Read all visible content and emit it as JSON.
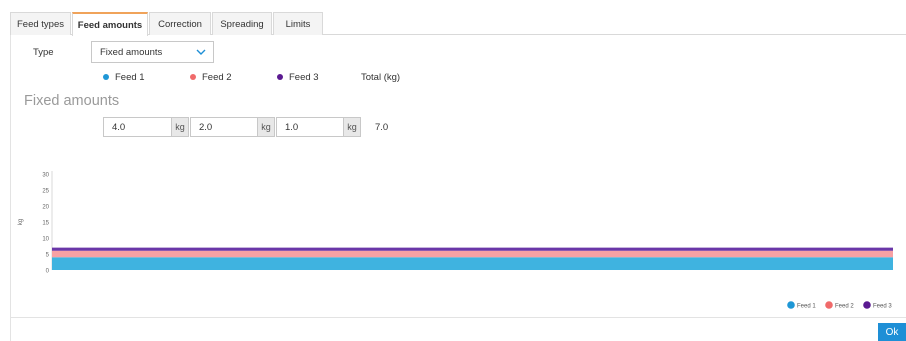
{
  "tabs": [
    {
      "label": "Feed types"
    },
    {
      "label": "Feed amounts"
    },
    {
      "label": "Correction"
    },
    {
      "label": "Spreading"
    },
    {
      "label": "Limits"
    }
  ],
  "type_row": {
    "label": "Type",
    "selected": "Fixed amounts"
  },
  "legend": [
    {
      "label": "Feed 1",
      "color": "#1f97d6"
    },
    {
      "label": "Feed 2",
      "color": "#f06a6a"
    },
    {
      "label": "Feed 3",
      "color": "#5b1a91"
    }
  ],
  "total_label": "Total (kg)",
  "section_title": "Fixed amounts",
  "amounts": [
    {
      "value": "4.0",
      "unit": "kg"
    },
    {
      "value": "2.0",
      "unit": "kg"
    },
    {
      "value": "1.0",
      "unit": "kg"
    }
  ],
  "total_value": "7.0",
  "ok_label": "Ok",
  "chart_data": {
    "type": "area",
    "stacked": true,
    "ylabel": "kg",
    "ylim": [
      0,
      30
    ],
    "yticks": [
      "30",
      "25",
      "20",
      "15",
      "10",
      "5",
      "0"
    ],
    "series": [
      {
        "name": "Feed 1",
        "values": [
          4.0,
          4.0
        ],
        "color": "#3fb3e0"
      },
      {
        "name": "Feed 2",
        "values": [
          2.0,
          2.0
        ],
        "color": "#f7a1a4"
      },
      {
        "name": "Feed 3",
        "values": [
          1.0,
          1.0
        ],
        "color": "#6a36a8"
      }
    ],
    "legend_position": "bottom-right",
    "legend": [
      {
        "label": "Feed 1",
        "color": "#1f97d6"
      },
      {
        "label": "Feed 2",
        "color": "#f06a6a"
      },
      {
        "label": "Feed 3",
        "color": "#5b1a91"
      }
    ]
  }
}
